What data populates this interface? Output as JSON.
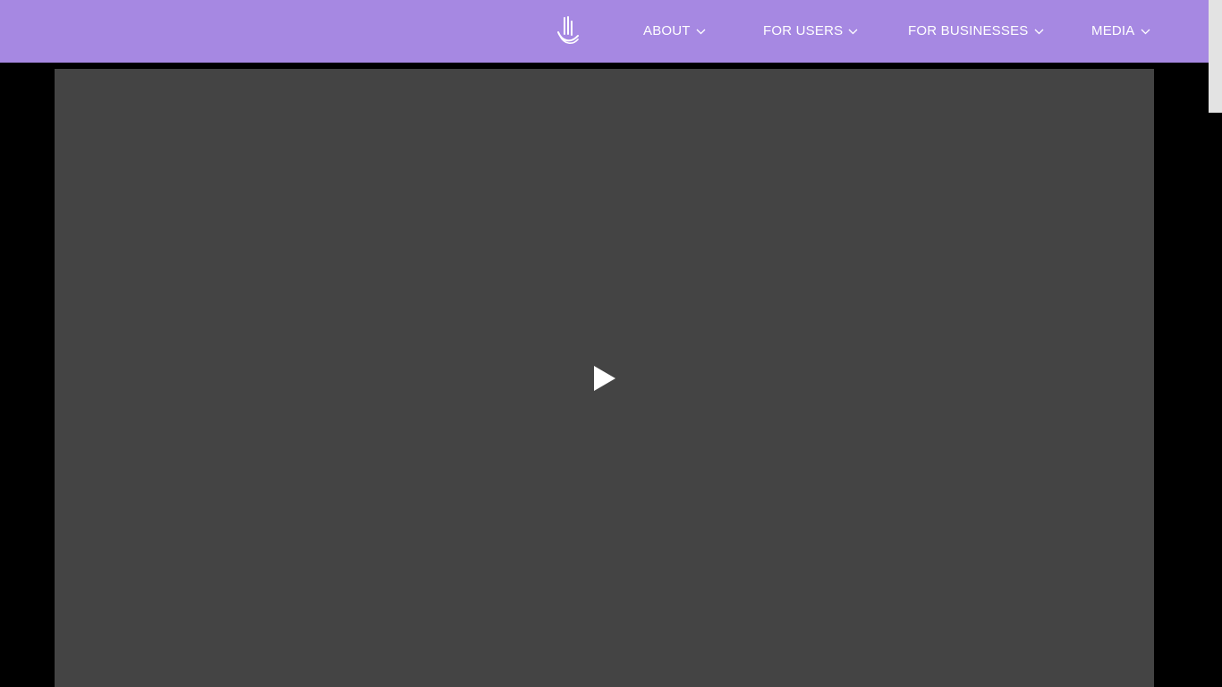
{
  "colors": {
    "navbar_bg": "#a688e2",
    "nav_text": "#ffffff",
    "page_bg": "#000000",
    "video_bg": "#444444",
    "scrollbar_thumb": "#e3e3e3"
  },
  "header": {
    "logo_icon": "hand-logo-icon",
    "nav": [
      {
        "label": "ABOUT",
        "icon": "chevron-down-icon"
      },
      {
        "label": "FOR USERS",
        "icon": "chevron-down-icon"
      },
      {
        "label": "FOR BUSINESSES",
        "icon": "chevron-down-icon"
      },
      {
        "label": "MEDIA",
        "icon": "chevron-down-icon"
      }
    ]
  },
  "main": {
    "video": {
      "play_icon": "play-icon"
    }
  }
}
